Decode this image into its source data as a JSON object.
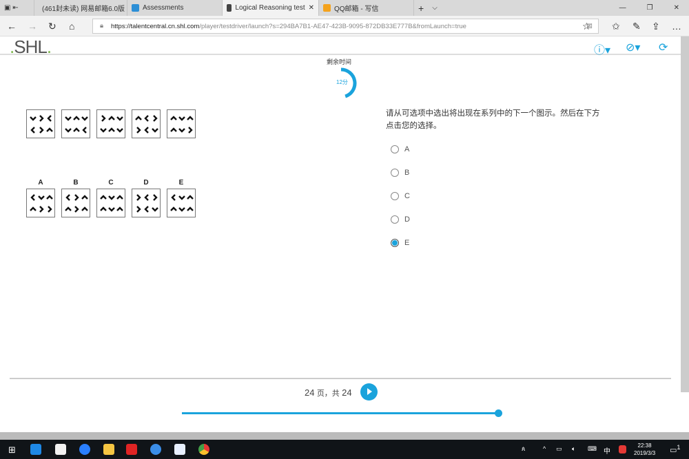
{
  "browser": {
    "tabs": [
      {
        "label": "(461封未读) 网易邮箱6.0版",
        "active": false,
        "color": "#d8262b"
      },
      {
        "label": "Assessments",
        "active": false,
        "color": "#2d8fd6"
      },
      {
        "label": "Logical Reasoning test",
        "active": true,
        "color": "#444444"
      },
      {
        "label": "QQ邮箱 - 写信",
        "active": false,
        "color": "#f4a21c"
      }
    ],
    "close_tab": "✕",
    "new_tab": "+",
    "tab_menu": "⌵",
    "window": {
      "minimize": "—",
      "restore": "❐",
      "close": "✕"
    },
    "url_host": "https://talentcentral.cn.shl.com",
    "url_path": "/player/testdriver/launch?s=294BA7B1-AE47-423B-9095-872DB33E777B&fromLaunch=true"
  },
  "app": {
    "logo": "SHL",
    "help_icon": "?",
    "accent": "#1aa3dc"
  },
  "timer": {
    "label": "剩余时间",
    "value": "12分",
    "fraction_remaining": 0.45
  },
  "question": {
    "series": [
      [
        [
          "down",
          "right",
          "left"
        ],
        [
          "left",
          "right",
          "up"
        ]
      ],
      [
        [
          "down",
          "up",
          "down"
        ],
        [
          "down",
          "up",
          "left"
        ]
      ],
      [
        [
          "right",
          "up",
          "down"
        ],
        [
          "down",
          "up",
          "down"
        ]
      ],
      [
        [
          "up",
          "left",
          "right"
        ],
        [
          "right",
          "left",
          "down"
        ]
      ],
      [
        [
          "up",
          "down",
          "up"
        ],
        [
          "up",
          "down",
          "right"
        ]
      ]
    ],
    "answers": [
      {
        "label": "A",
        "grid": [
          [
            "left",
            "down",
            "up"
          ],
          [
            "up",
            "right",
            "right"
          ]
        ]
      },
      {
        "label": "B",
        "grid": [
          [
            "left",
            "right",
            "up"
          ],
          [
            "up",
            "right",
            "up"
          ]
        ]
      },
      {
        "label": "C",
        "grid": [
          [
            "up",
            "down",
            "up"
          ],
          [
            "up",
            "down",
            "up"
          ]
        ]
      },
      {
        "label": "D",
        "grid": [
          [
            "right",
            "left",
            "right"
          ],
          [
            "right",
            "left",
            "down"
          ]
        ]
      },
      {
        "label": "E",
        "grid": [
          [
            "left",
            "down",
            "up"
          ],
          [
            "up",
            "down",
            "up"
          ]
        ]
      }
    ],
    "instruction": "请从可选项中选出将出现在系列中的下一个图示。然后在下方点击您的选择。",
    "options": [
      "A",
      "B",
      "C",
      "D",
      "E"
    ],
    "selected": "E"
  },
  "footer": {
    "page_current": "24",
    "page_sep": "页，共",
    "page_total": "24",
    "progress": 1.0
  },
  "taskbar": {
    "time": "22:38",
    "date": "2019/3/3",
    "ime": "中",
    "notifications": "1"
  }
}
